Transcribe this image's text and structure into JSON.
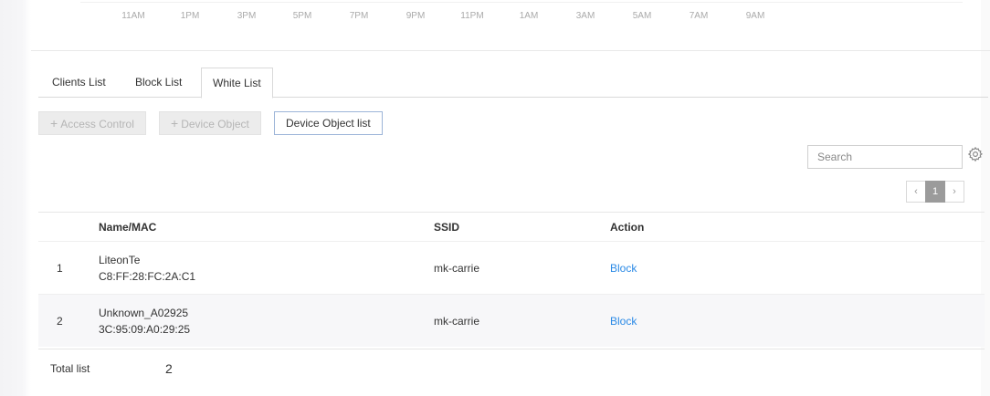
{
  "timeline": {
    "ticks": [
      "11AM",
      "1PM",
      "3PM",
      "5PM",
      "7PM",
      "9PM",
      "11PM",
      "1AM",
      "3AM",
      "5AM",
      "7AM",
      "9AM"
    ]
  },
  "tabs": [
    {
      "label": "Clients List",
      "active": false
    },
    {
      "label": "Block List",
      "active": false
    },
    {
      "label": "White List",
      "active": true
    }
  ],
  "toolbar": {
    "access_control": "Access Control",
    "device_object": "Device Object",
    "device_object_list": "Device Object list",
    "plus": "+"
  },
  "search": {
    "placeholder": "Search"
  },
  "pagination": {
    "prev": "‹",
    "current": "1",
    "next": "›"
  },
  "table": {
    "headers": {
      "name_mac": "Name/MAC",
      "ssid": "SSID",
      "action": "Action"
    },
    "rows": [
      {
        "index": "1",
        "name": "LiteonTe",
        "mac": "C8:FF:28:FC:2A:C1",
        "ssid": "mk-carrie",
        "action": "Block"
      },
      {
        "index": "2",
        "name": "Unknown_A02925",
        "mac": "3C:95:09:A0:29:25",
        "ssid": "mk-carrie",
        "action": "Block"
      }
    ]
  },
  "footer": {
    "total_label": "Total list",
    "total_count": "2"
  },
  "colors": {
    "link": "#2b8ae6",
    "pager_active": "#9b9b9b",
    "outline_button_border": "#9cb4d8"
  },
  "icons": {
    "settings": "gear-icon"
  }
}
